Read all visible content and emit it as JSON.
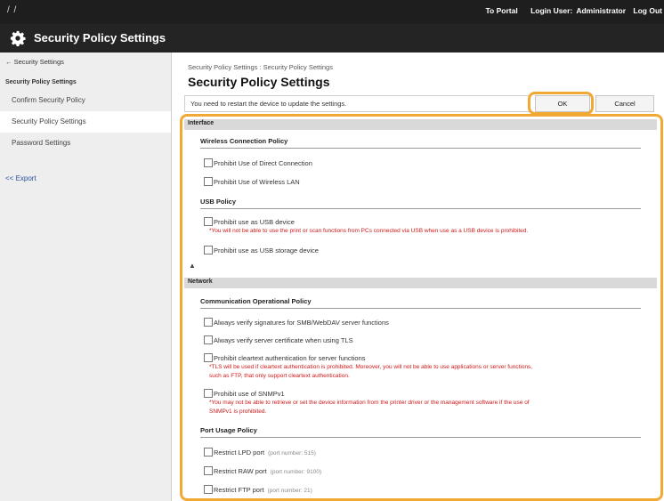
{
  "topbar": {
    "slashes": "/ /",
    "to_portal": "To Portal",
    "login_user": "Login User:",
    "user": "Administrator",
    "logout": "Log Out"
  },
  "header": {
    "title": "Security Policy Settings"
  },
  "sidebar": {
    "back": "← Security Settings",
    "group": "Security Policy Settings",
    "items": [
      {
        "label": "Confirm Security Policy"
      },
      {
        "label": "Security Policy Settings"
      },
      {
        "label": "Password Settings"
      }
    ],
    "export": "<< Export"
  },
  "main": {
    "breadcrumb": "Security Policy Settings : Security Policy Settings",
    "title": "Security Policy Settings",
    "notice": "You need to restart the device to update the settings.",
    "ok": "OK",
    "cancel": "Cancel"
  },
  "interface": {
    "header": "Interface",
    "wireless_title": "Wireless Connection Policy",
    "wireless": [
      "Prohibit Use of Direct Connection",
      "Prohibit Use of Wireless LAN"
    ],
    "usb_title": "USB Policy",
    "usb_device": "Prohibit use as USB device",
    "usb_warn": "*You will not be able to use the print or scan functions from PCs connected via USB when use as a USB device is prohibited.",
    "usb_storage": "Prohibit use as USB storage device",
    "collapse": "▲"
  },
  "network": {
    "header": "Network",
    "comm_title": "Communication Operational Policy",
    "verify_smb": "Always verify signatures for SMB/WebDAV server functions",
    "verify_tls": "Always verify server certificate when using TLS",
    "cleartext": "Prohibit cleartext authentication for server functions",
    "cleartext_warn1": "*TLS will be used if cleartext authentication is prohibited. Moreover, you will not be able to use applications or server functions,",
    "cleartext_warn2": "such as FTP, that only support cleartext authentication.",
    "snmp": "Prohibit use of SNMPv1",
    "snmp_warn1": "*You may not be able to retrieve or set the device information from the printer driver or the management software if the use of",
    "snmp_warn2": "SNMPv1 is prohibited.",
    "port_title": "Port Usage Policy",
    "lpd": "Restrict LPD port",
    "lpd_port": "(port number: 515)",
    "raw": "Restrict RAW port",
    "raw_port": "(port number: 9100)",
    "ftp": "Restrict FTP port",
    "ftp_port": "(port number: 21)"
  }
}
